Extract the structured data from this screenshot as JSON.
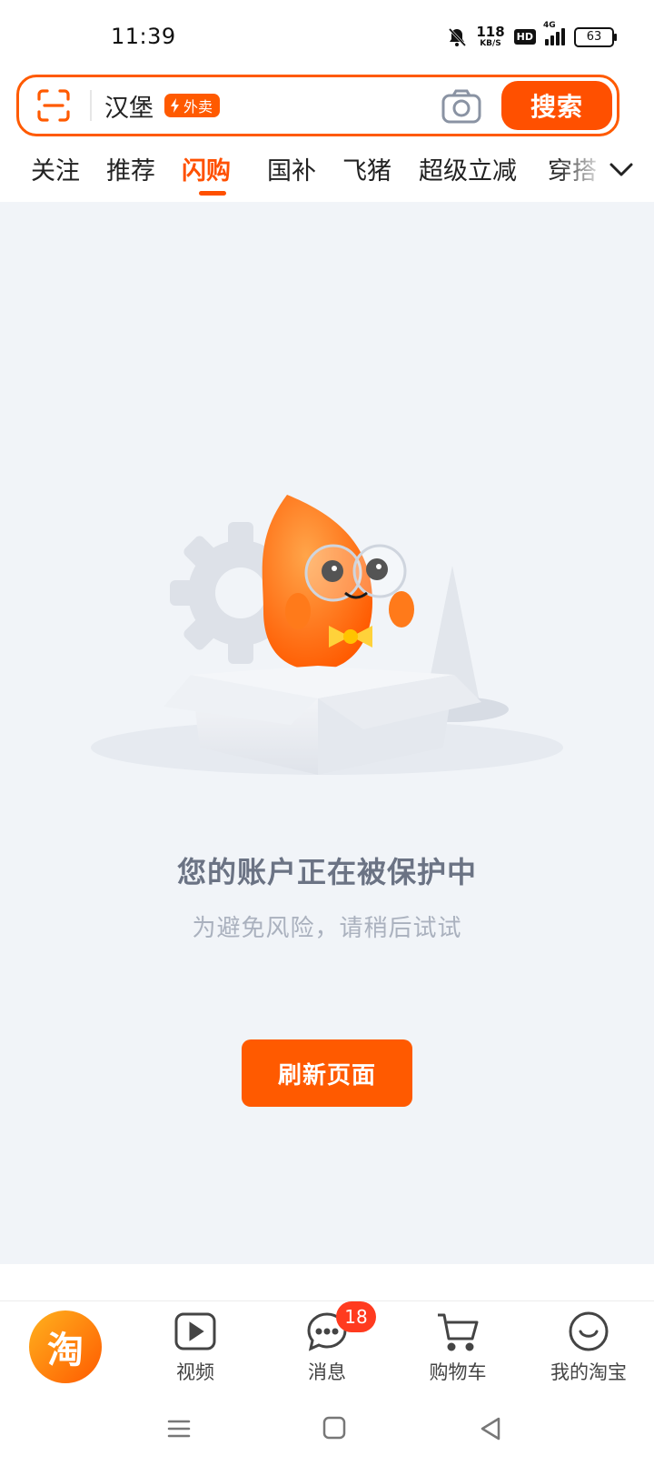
{
  "status_bar": {
    "time": "11:39",
    "net_speed_value": "118",
    "net_speed_unit": "KB/S",
    "hd_label": "HD",
    "network_label": "4G",
    "battery_level": "63"
  },
  "search": {
    "query": "汉堡",
    "badge_label": "外卖",
    "button_label": "搜索"
  },
  "tabs": {
    "items": [
      {
        "label": "关注"
      },
      {
        "label": "推荐"
      },
      {
        "label": "闪购"
      },
      {
        "label": "国补"
      },
      {
        "label": "飞猪"
      },
      {
        "label": "超级立减"
      },
      {
        "label": "穿搭"
      }
    ],
    "active_index": 2
  },
  "main": {
    "status_title": "您的账户正在被保护中",
    "status_subtitle": "为避免风险，请稍后试试",
    "refresh_button_label": "刷新页面"
  },
  "bottom_nav": {
    "home_glyph": "淘",
    "items": [
      {
        "label": "视频",
        "icon": "video-icon"
      },
      {
        "label": "消息",
        "icon": "message-icon",
        "badge": "18"
      },
      {
        "label": "购物车",
        "icon": "cart-icon"
      },
      {
        "label": "我的淘宝",
        "icon": "profile-smile-icon"
      }
    ]
  },
  "colors": {
    "accent": "#ff5000",
    "content_bg": "#f1f4f8",
    "title_text": "#6b7384",
    "subtitle_text": "#aab1be"
  }
}
